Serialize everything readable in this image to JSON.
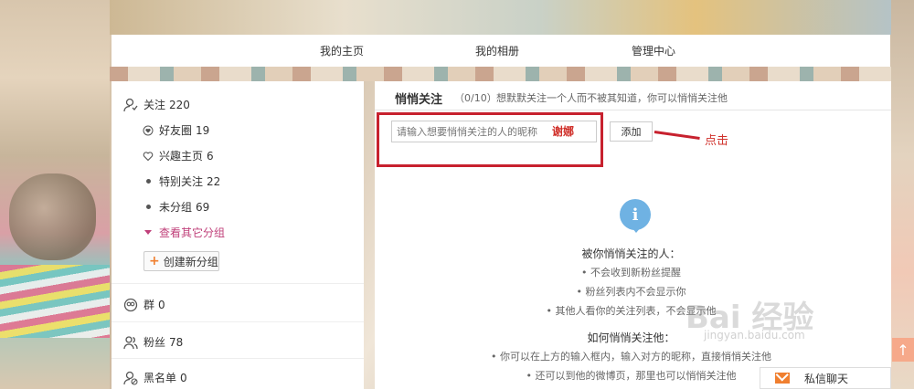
{
  "topnav": {
    "items": [
      "我的主页",
      "我的相册",
      "管理中心"
    ]
  },
  "leftpanel": {
    "follow": {
      "label": "关注",
      "count": "220"
    },
    "sub": [
      {
        "label": "好友圈",
        "count": "19",
        "icon": "circle-heart-icon"
      },
      {
        "label": "兴趣主页",
        "count": "6",
        "icon": "heart-outline-icon"
      },
      {
        "label": "特别关注",
        "count": "22",
        "icon": "dot-icon"
      },
      {
        "label": "未分组",
        "count": "69",
        "icon": "dot-icon"
      }
    ],
    "more": "查看其它分组",
    "create": "创建新分组",
    "groups": {
      "label": "群",
      "count": "0"
    },
    "fans": {
      "label": "粉丝",
      "count": "78"
    },
    "blacklist": {
      "label": "黑名单",
      "count": "0"
    }
  },
  "rightpanel": {
    "title": "悄悄关注",
    "count": "（0/10）",
    "desc": "想默默关注一个人而不被其知道，你可以悄悄关注他",
    "input_placeholder": "请输入想要悄悄关注的人的昵称",
    "typed_note": "谢娜",
    "add_button": "添加",
    "click_label": "点击",
    "section1_title": "被你悄悄关注的人：",
    "section1_items": [
      "• 不会收到新粉丝提醒",
      "• 粉丝列表内不会显示你",
      "• 其他人看你的关注列表，不会显示他"
    ],
    "section2_title": "如何悄悄关注他：",
    "section2_items": [
      "• 你可以在上方的输入框内，输入对方的昵称，直接悄悄关注他",
      "• 还可以到他的微博页，那里也可以悄悄关注他"
    ]
  },
  "watermark": {
    "main": "Bai 经验",
    "sub": "jingyan.baidu.com"
  },
  "chat": {
    "label": "私信聊天"
  },
  "colors": {
    "accent_red": "#c7212e",
    "info_blue": "#6fb2e3",
    "link_pink": "#c0407a",
    "orange": "#f07f2f"
  }
}
